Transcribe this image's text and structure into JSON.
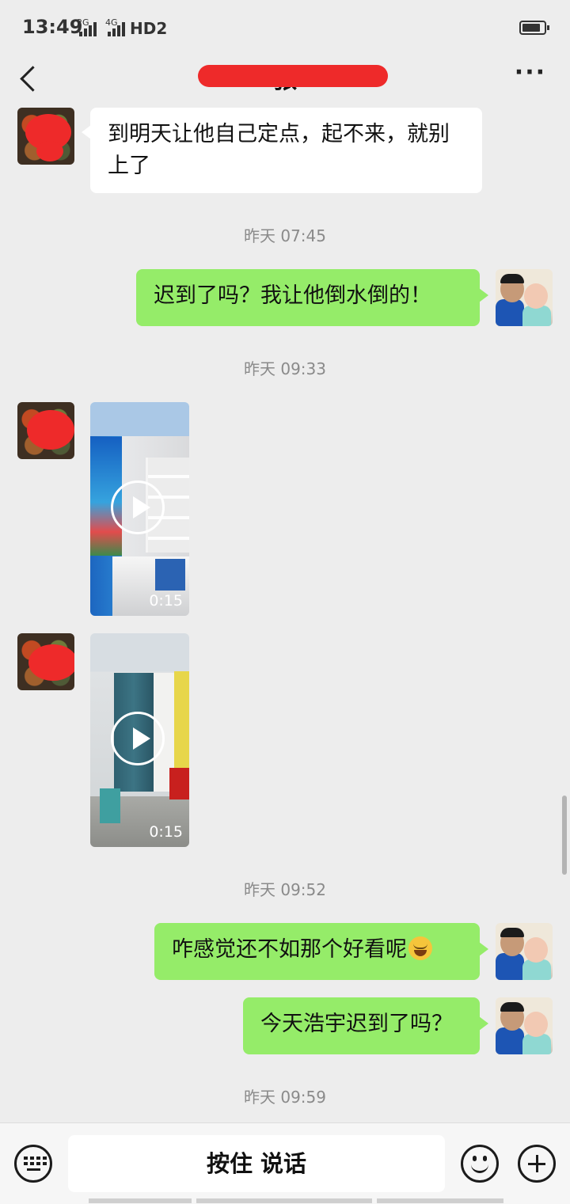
{
  "status_bar": {
    "time": "13:49",
    "net1": "2G",
    "net2": "4G",
    "hd": "HD2"
  },
  "header": {
    "title": "张",
    "title_redacted": true
  },
  "messages": [
    {
      "side": "in",
      "type": "text",
      "text": "到明天让他自己定点，起不来，就别上了"
    },
    {
      "type": "time",
      "text": "昨天 07:45"
    },
    {
      "side": "out",
      "type": "text",
      "text": "迟到了吗？我让他倒水倒的！"
    },
    {
      "type": "time",
      "text": "昨天 09:33"
    },
    {
      "side": "in",
      "type": "video",
      "duration": "0:15"
    },
    {
      "side": "in",
      "type": "video",
      "duration": "0:15"
    },
    {
      "type": "time",
      "text": "昨天 09:52"
    },
    {
      "side": "out",
      "type": "text",
      "text": "咋感觉还不如那个好看呢",
      "emoji": "laughing-crying-emoji"
    },
    {
      "side": "out",
      "type": "text",
      "text": "今天浩宇迟到了吗？"
    },
    {
      "type": "time",
      "text": "昨天 09:59"
    }
  ],
  "input_bar": {
    "voice_label": "按住 说话"
  },
  "colors": {
    "out_bubble": "#95ec69",
    "in_bubble": "#ffffff",
    "background": "#ededed",
    "redaction": "#ee2a2a"
  }
}
